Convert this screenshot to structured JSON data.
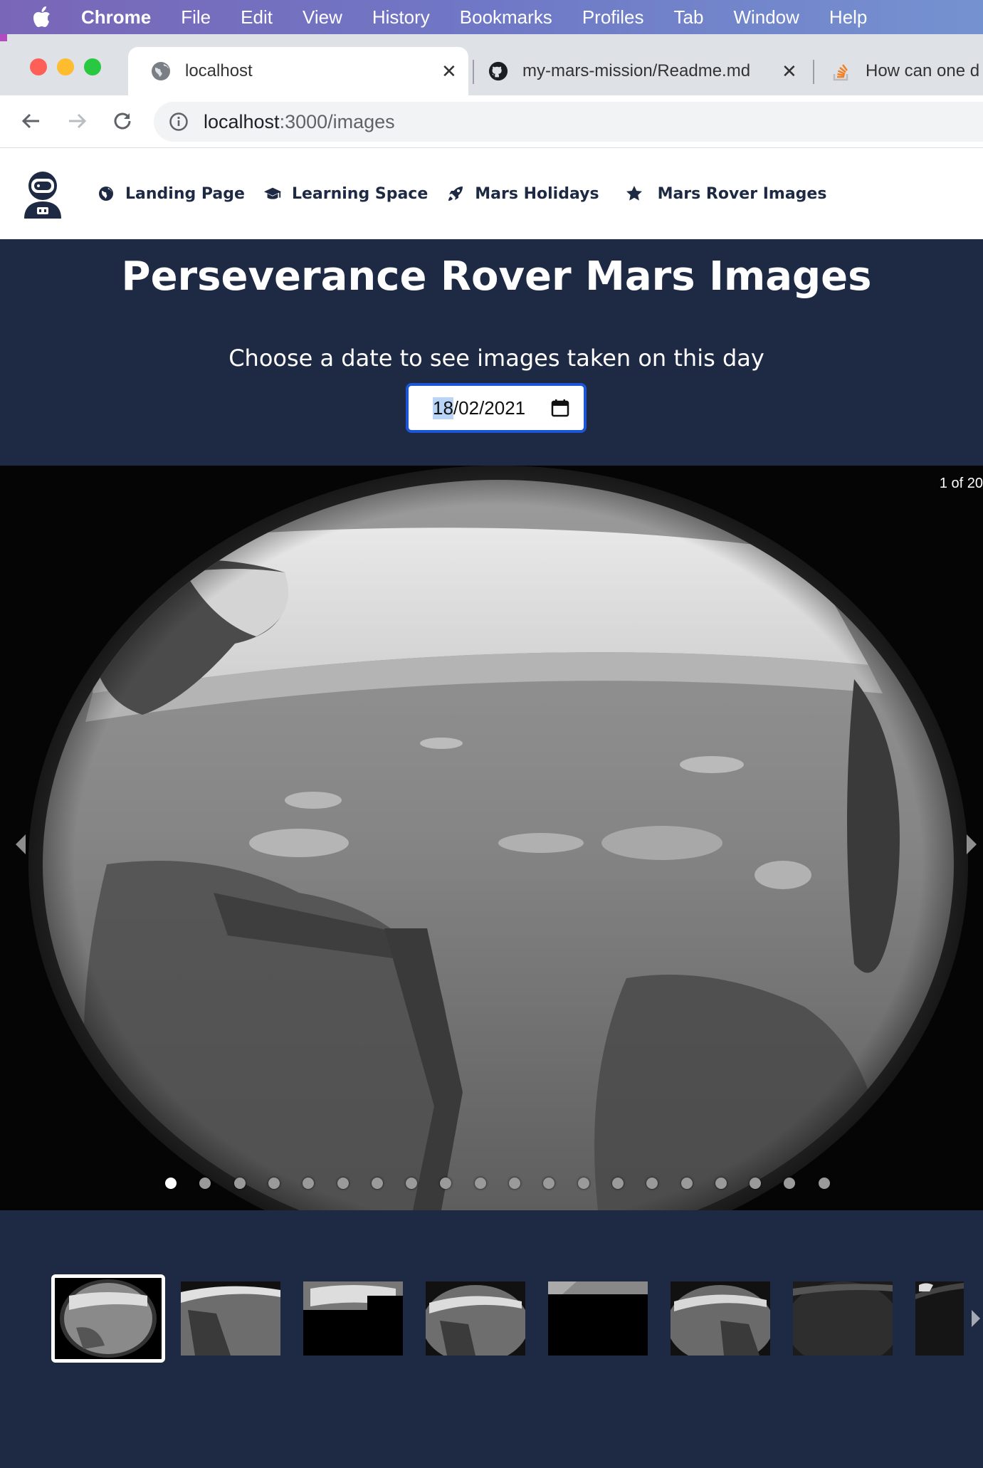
{
  "menubar": {
    "app": "Chrome",
    "items": [
      "File",
      "Edit",
      "View",
      "History",
      "Bookmarks",
      "Profiles",
      "Tab",
      "Window",
      "Help"
    ]
  },
  "tabs": [
    {
      "title": "localhost",
      "icon": "globe-icon",
      "close": "✕"
    },
    {
      "title": "my-mars-mission/Readme.md",
      "icon": "github-icon",
      "close": "✕"
    },
    {
      "title": "How can one d",
      "icon": "stackoverflow-icon"
    }
  ],
  "addressbar": {
    "host": "localhost",
    "path": ":3000/images"
  },
  "sitenav": {
    "links": [
      {
        "label": "Landing Page",
        "icon": "globe-icon"
      },
      {
        "label": "Learning Space",
        "icon": "graduation-cap-icon"
      },
      {
        "label": "Mars Holidays",
        "icon": "rocket-icon"
      },
      {
        "label": "Mars Rover Images",
        "icon": "star-icon"
      }
    ]
  },
  "main": {
    "title": "Perseverance Rover Mars Images",
    "prompt": "Choose a date to see images taken on this day",
    "date": {
      "day": "18",
      "rest": "/02/2021"
    }
  },
  "carousel": {
    "counter": "1 of 20",
    "total": 20,
    "current": 1
  },
  "thumbnails": {
    "count": 8,
    "selected": 0
  },
  "colors": {
    "page_bg": "#1e2a44",
    "nav_text": "#1e2a44",
    "date_border": "#1a56d6"
  }
}
